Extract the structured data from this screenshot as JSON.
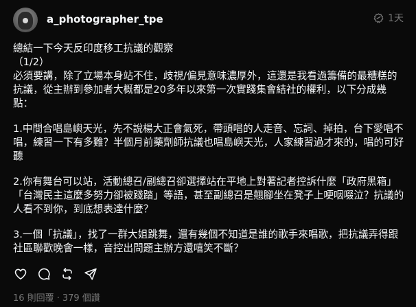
{
  "post": {
    "username": "a_photographer_tpe",
    "time": "1天",
    "paragraphs": [
      "總結一下今天反印度移工抗議的觀察\n（1/2）\n必須要講，除了立場本身站不住，歧視/偏見意味濃厚外，這還是我看過籌備的最糟糕的抗議，從主辦到參加者大概都是20多年以來第一次實踐集會結社的權利，以下分成幾點：",
      "1.中間合唱島嶼天光，先不說楊大正會氣死，帶頭唱的人走音、忘詞、掉拍，台下愛唱不唱，練習一下有多難？半個月前藥劑師抗議也唱島嶼天光，人家練習過才來的，唱的可好聽",
      "2.你有舞台可以站，活動總召/副總召卻選擇站在平地上對著記者控訴什麼「政府黑箱」「台灣民主這麼多努力卻被踐踏」等語，甚至副總召是翹腳坐在凳子上哽咽啜泣？抗議的人看不到你，到底想表達什麼？",
      "3.一個「抗議」，找了一群大姐跳舞，還有幾個不知道是誰的歌手來唱歌，把抗議弄得跟社區聯歡晚會一樣，音控出問題主辦方還嘻笑不斷？"
    ],
    "footer": {
      "replies": "16 則回覆",
      "separator": "·",
      "views": "379 個讚"
    }
  },
  "icons": {
    "badge": "pending-badge-icon",
    "like": "heart-icon",
    "reply": "comment-icon",
    "repost": "repost-icon",
    "share": "share-icon"
  },
  "colors": {
    "background": "#0a0a0a",
    "text": "#f3f5f7",
    "muted": "#777777"
  }
}
